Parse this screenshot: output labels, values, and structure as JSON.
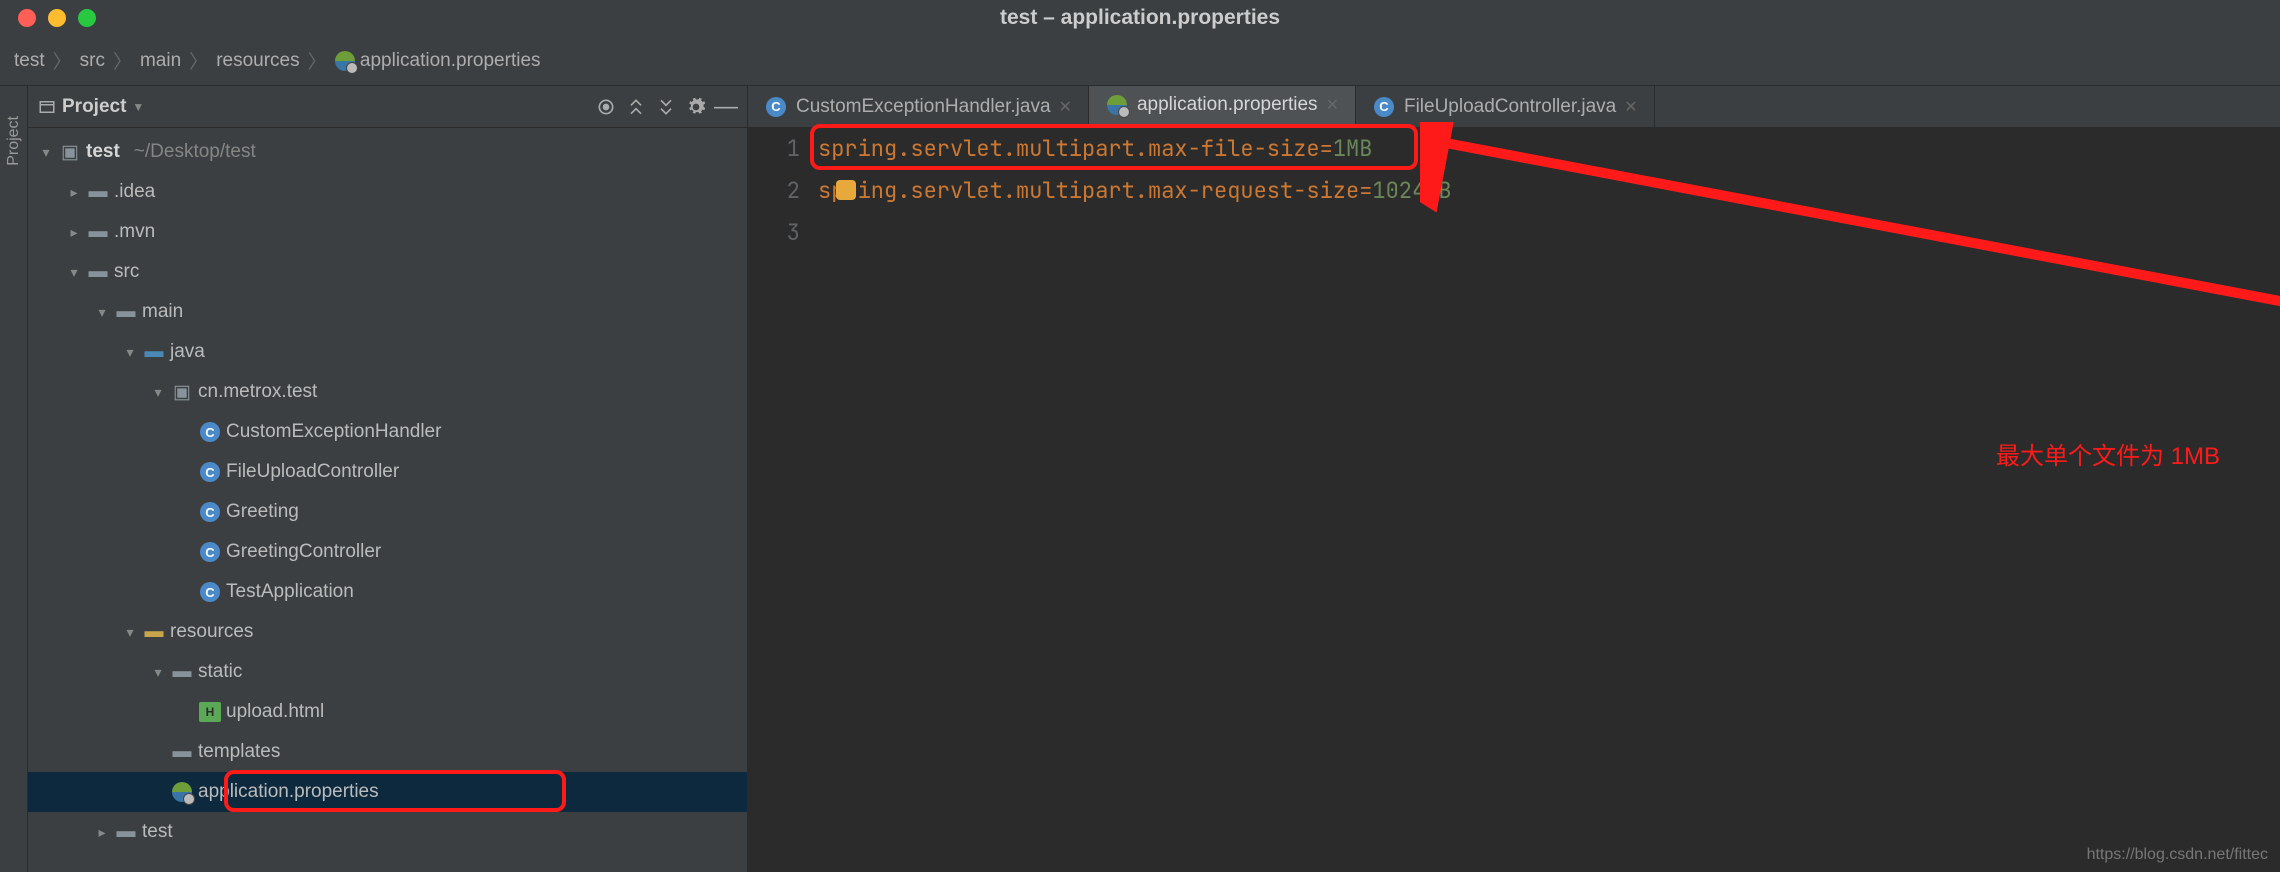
{
  "window_title": "test – application.properties",
  "breadcrumb": [
    "test",
    "src",
    "main",
    "resources",
    "application.properties"
  ],
  "sidebar_rail": "Project",
  "project_panel": {
    "title": "Project"
  },
  "tree": {
    "root": {
      "name": "test",
      "path": "~/Desktop/test"
    },
    "idea": ".idea",
    "mvn": ".mvn",
    "src": "src",
    "main": "main",
    "java": "java",
    "package": "cn.metrox.test",
    "classes": [
      "CustomExceptionHandler",
      "FileUploadController",
      "Greeting",
      "GreetingController",
      "TestApplication"
    ],
    "resources": "resources",
    "static": "static",
    "upload": "upload.html",
    "templates": "templates",
    "app_props": "application.properties",
    "test_folder": "test"
  },
  "tabs": [
    {
      "label": "CustomExceptionHandler.java",
      "type": "class"
    },
    {
      "label": "application.properties",
      "type": "props",
      "active": true
    },
    {
      "label": "FileUploadController.java",
      "type": "class"
    }
  ],
  "code": {
    "lines": [
      {
        "n": 1,
        "key": "spring.servlet.multipart.max-file-size=",
        "val": "1MB"
      },
      {
        "n": 2,
        "key": "spring.servlet.multipart.max-request-size=",
        "val": "1024MB"
      },
      {
        "n": 3,
        "key": "",
        "val": ""
      }
    ]
  },
  "annotation": "最大单个文件为 1MB",
  "watermark": "https://blog.csdn.net/fittec"
}
